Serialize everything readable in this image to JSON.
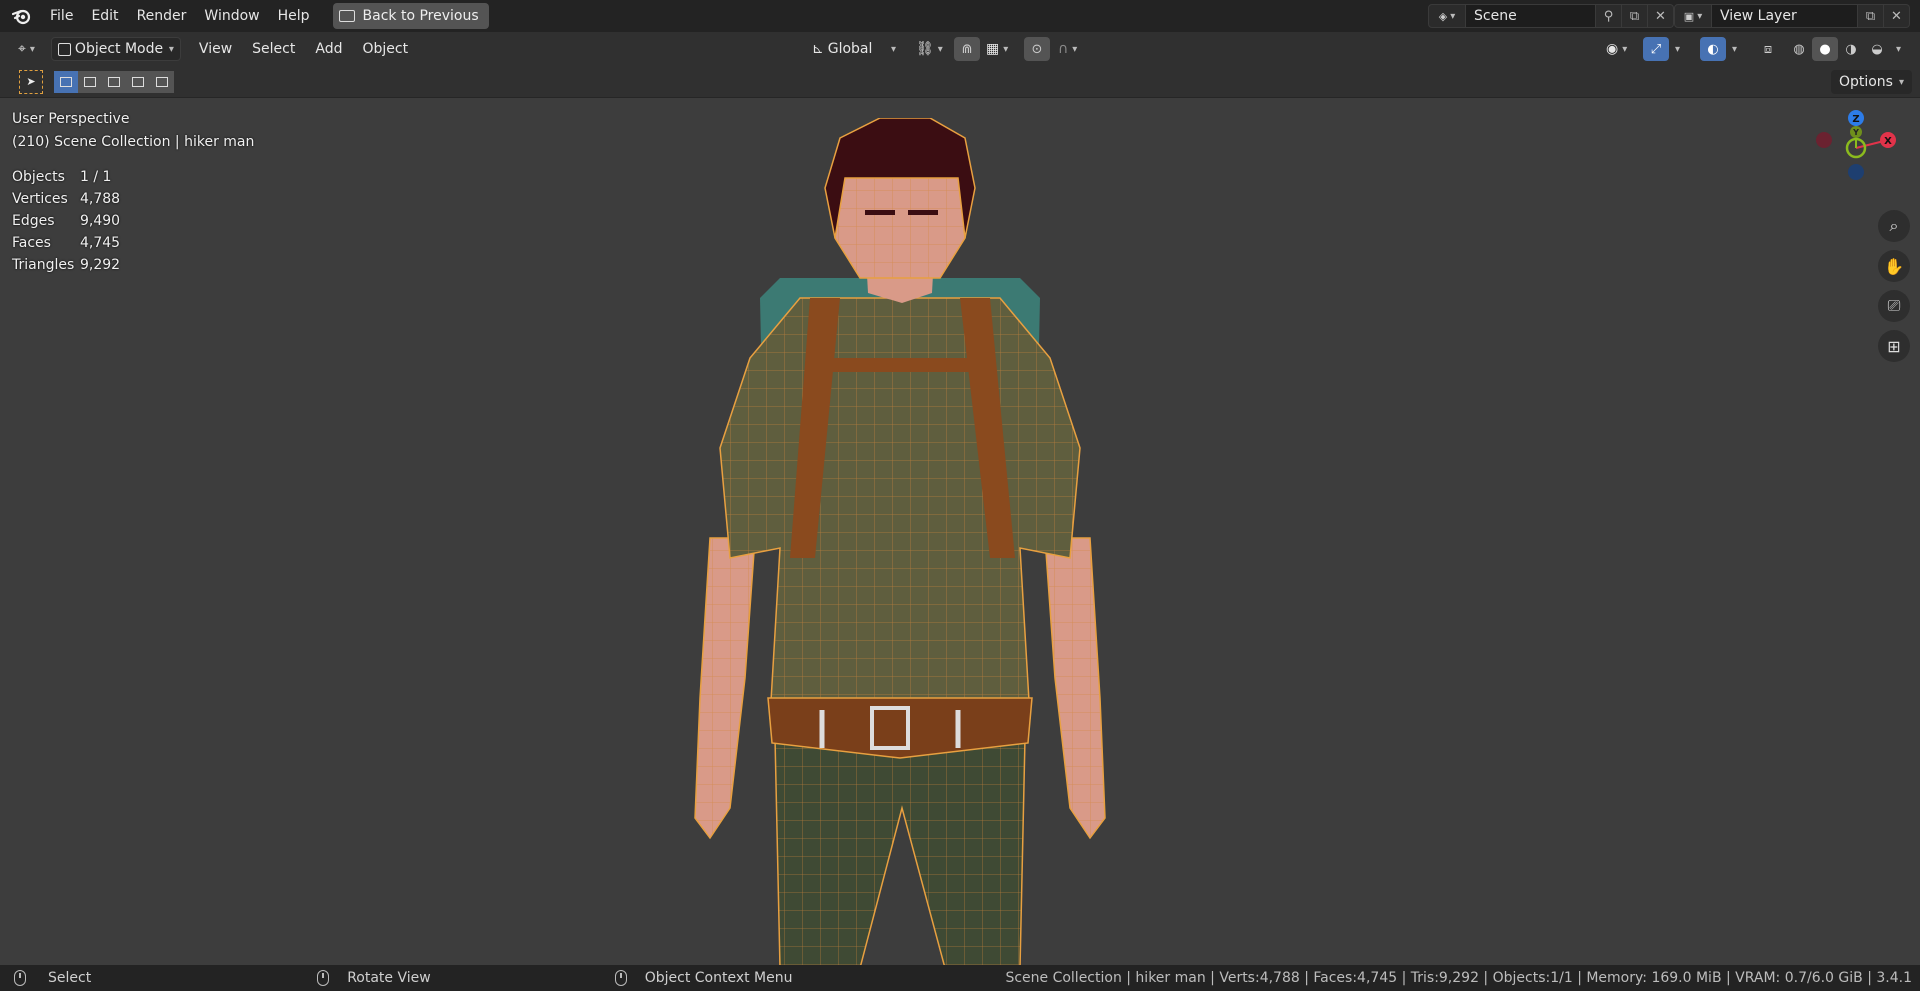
{
  "topbar": {
    "menus": [
      "File",
      "Edit",
      "Render",
      "Window",
      "Help"
    ],
    "back_button": "Back to Previous",
    "scene_name": "Scene",
    "view_layer": "View Layer"
  },
  "header": {
    "mode": "Object Mode",
    "menus": [
      "View",
      "Select",
      "Add",
      "Object"
    ],
    "transform_orientation": "Global"
  },
  "toolbar": {
    "options_label": "Options"
  },
  "viewport": {
    "perspective": "User Perspective",
    "collection": "(210) Scene Collection | hiker man",
    "stats": [
      {
        "label": "Objects",
        "value": "1 / 1"
      },
      {
        "label": "Vertices",
        "value": "4,788"
      },
      {
        "label": "Edges",
        "value": "9,490"
      },
      {
        "label": "Faces",
        "value": "4,745"
      },
      {
        "label": "Triangles",
        "value": "9,292"
      }
    ],
    "gizmo": {
      "x": "X",
      "y": "Y",
      "z": "Z"
    }
  },
  "statusbar": {
    "select": "Select",
    "rotate": "Rotate View",
    "context": "Object Context Menu",
    "info": "Scene Collection | hiker man | Verts:4,788 | Faces:4,745 | Tris:9,292 | Objects:1/1 | Memory: 169.0 MiB | VRAM: 0.7/6.0 GiB | 3.4.1"
  },
  "colors": {
    "viewport_bg": "#3d3d3d",
    "accent": "#4772b3",
    "selection_outline": "#e8a040",
    "axis_x": "#e2334a",
    "axis_y": "#8bbb1e",
    "axis_z": "#2d7ce8"
  }
}
